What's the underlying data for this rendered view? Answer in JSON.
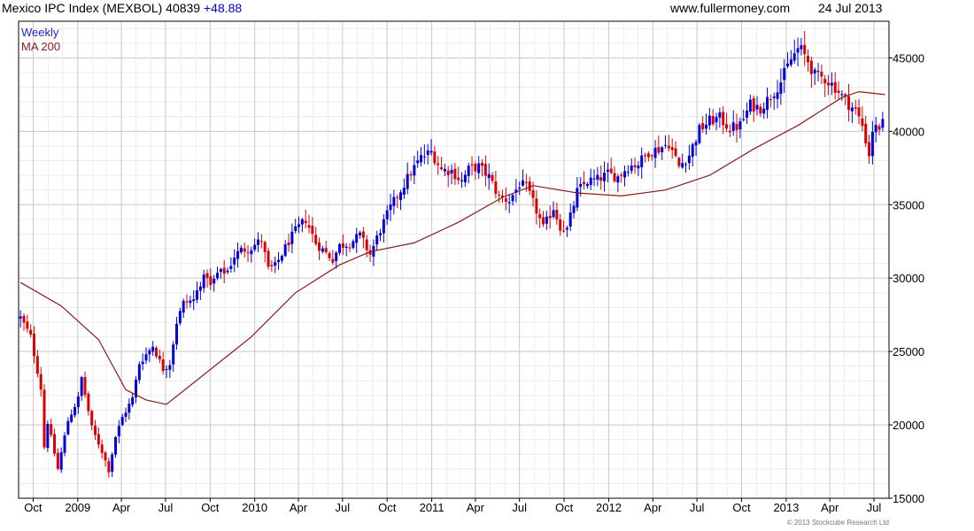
{
  "header": {
    "title": "Mexico IPC Index (MEXBOL) 40839",
    "change": "+48.88",
    "site": "www.fullermoney.com",
    "date": "24 Jul 2013"
  },
  "legend": {
    "weekly_label": "Weekly",
    "ma_label": "MA 200"
  },
  "copyright": "© 2013 Stockcube Research Ltd",
  "colors": {
    "up": "#0000dd",
    "down": "#dd0000",
    "ma": "#8b1a1a",
    "grid": "#dcdcdc",
    "weekly_text": "#2222cc",
    "ma_text": "#8b1a1a"
  },
  "chart_data": {
    "type": "candlestick",
    "title": "Mexico IPC Index (MEXBOL) 40839",
    "x_range": [
      "2008-09-01",
      "2013-08-01"
    ],
    "y_range": [
      15000,
      47500
    ],
    "y_ticks": [
      15000,
      20000,
      25000,
      30000,
      35000,
      40000,
      45000
    ],
    "x_ticks": [
      {
        "date": "2008-10-01",
        "label": "Oct"
      },
      {
        "date": "2009-01-01",
        "label": "2009"
      },
      {
        "date": "2009-04-01",
        "label": "Apr"
      },
      {
        "date": "2009-07-01",
        "label": "Jul"
      },
      {
        "date": "2009-10-01",
        "label": "Oct"
      },
      {
        "date": "2010-01-01",
        "label": "2010"
      },
      {
        "date": "2010-04-01",
        "label": "Apr"
      },
      {
        "date": "2010-07-01",
        "label": "Jul"
      },
      {
        "date": "2010-10-01",
        "label": "Oct"
      },
      {
        "date": "2011-01-01",
        "label": "2011"
      },
      {
        "date": "2011-04-01",
        "label": "Apr"
      },
      {
        "date": "2011-07-01",
        "label": "Jul"
      },
      {
        "date": "2011-10-01",
        "label": "Oct"
      },
      {
        "date": "2012-01-01",
        "label": "2012"
      },
      {
        "date": "2012-04-01",
        "label": "Apr"
      },
      {
        "date": "2012-07-01",
        "label": "Jul"
      },
      {
        "date": "2012-10-01",
        "label": "Oct"
      },
      {
        "date": "2013-01-01",
        "label": "2013"
      },
      {
        "date": "2013-04-01",
        "label": "Apr"
      },
      {
        "date": "2013-07-01",
        "label": "Jul"
      }
    ],
    "weekly_close_path": [
      [
        "2008-09-05",
        27300
      ],
      [
        "2008-09-26",
        26000
      ],
      [
        "2008-10-17",
        22500
      ],
      [
        "2008-10-24",
        18500
      ],
      [
        "2008-10-31",
        20200
      ],
      [
        "2008-11-21",
        17000
      ],
      [
        "2008-12-12",
        20300
      ],
      [
        "2009-01-02",
        21800
      ],
      [
        "2009-01-09",
        23200
      ],
      [
        "2009-01-30",
        19800
      ],
      [
        "2009-02-20",
        18200
      ],
      [
        "2009-03-06",
        16900
      ],
      [
        "2009-03-20",
        19200
      ],
      [
        "2009-04-03",
        20500
      ],
      [
        "2009-04-24",
        21800
      ],
      [
        "2009-05-08",
        24200
      ],
      [
        "2009-06-05",
        25400
      ],
      [
        "2009-06-26",
        23800
      ],
      [
        "2009-07-10",
        24200
      ],
      [
        "2009-07-24",
        27000
      ],
      [
        "2009-08-07",
        28300
      ],
      [
        "2009-08-28",
        28500
      ],
      [
        "2009-09-11",
        29700
      ],
      [
        "2009-09-25",
        30200
      ],
      [
        "2009-10-02",
        29400
      ],
      [
        "2009-10-16",
        30300
      ],
      [
        "2009-11-06",
        30500
      ],
      [
        "2009-11-20",
        31500
      ],
      [
        "2009-12-04",
        31900
      ],
      [
        "2009-12-25",
        32100
      ],
      [
        "2010-01-15",
        32600
      ],
      [
        "2010-01-29",
        30600
      ],
      [
        "2010-02-12",
        30800
      ],
      [
        "2010-03-12",
        32500
      ],
      [
        "2010-03-26",
        33200
      ],
      [
        "2010-04-16",
        34000
      ],
      [
        "2010-05-07",
        32400
      ],
      [
        "2010-05-28",
        31700
      ],
      [
        "2010-06-11",
        31300
      ],
      [
        "2010-06-25",
        32200
      ],
      [
        "2010-07-16",
        32400
      ],
      [
        "2010-08-06",
        32900
      ],
      [
        "2010-08-27",
        31600
      ],
      [
        "2010-09-17",
        33300
      ],
      [
        "2010-10-08",
        34800
      ],
      [
        "2010-10-29",
        36000
      ],
      [
        "2010-11-19",
        37200
      ],
      [
        "2010-12-10",
        38200
      ],
      [
        "2010-12-31",
        38600
      ],
      [
        "2011-01-21",
        37400
      ],
      [
        "2011-02-11",
        37300
      ],
      [
        "2011-03-04",
        36600
      ],
      [
        "2011-03-18",
        37400
      ],
      [
        "2011-04-08",
        37600
      ],
      [
        "2011-04-29",
        36900
      ],
      [
        "2011-05-20",
        35500
      ],
      [
        "2011-06-10",
        35300
      ],
      [
        "2011-07-01",
        36400
      ],
      [
        "2011-07-15",
        36200
      ],
      [
        "2011-08-05",
        34600
      ],
      [
        "2011-08-19",
        33400
      ],
      [
        "2011-09-09",
        34800
      ],
      [
        "2011-09-23",
        33500
      ],
      [
        "2011-10-07",
        33300
      ],
      [
        "2011-10-28",
        35900
      ],
      [
        "2011-11-18",
        36600
      ],
      [
        "2011-12-09",
        36700
      ],
      [
        "2011-12-30",
        37100
      ],
      [
        "2012-01-20",
        36900
      ],
      [
        "2012-02-10",
        37600
      ],
      [
        "2012-03-02",
        37800
      ],
      [
        "2012-03-23",
        38600
      ],
      [
        "2012-04-13",
        38800
      ],
      [
        "2012-05-04",
        39200
      ],
      [
        "2012-05-25",
        37600
      ],
      [
        "2012-06-15",
        38400
      ],
      [
        "2012-07-06",
        40100
      ],
      [
        "2012-07-27",
        40700
      ],
      [
        "2012-08-17",
        40900
      ],
      [
        "2012-09-07",
        40200
      ],
      [
        "2012-09-28",
        40400
      ],
      [
        "2012-10-19",
        41800
      ],
      [
        "2012-11-09",
        41600
      ],
      [
        "2012-11-30",
        42400
      ],
      [
        "2012-12-21",
        43400
      ],
      [
        "2013-01-11",
        44900
      ],
      [
        "2013-01-25",
        45600
      ],
      [
        "2013-02-01",
        45500
      ],
      [
        "2013-02-15",
        44800
      ],
      [
        "2013-03-01",
        43800
      ],
      [
        "2013-03-22",
        43600
      ],
      [
        "2013-04-12",
        43000
      ],
      [
        "2013-05-03",
        42100
      ],
      [
        "2013-05-24",
        41400
      ],
      [
        "2013-06-07",
        40400
      ],
      [
        "2013-06-21",
        38400
      ],
      [
        "2013-06-28",
        40100
      ],
      [
        "2013-07-12",
        40300
      ],
      [
        "2013-07-24",
        40839
      ]
    ],
    "ma200_path": [
      [
        "2008-09-05",
        29700
      ],
      [
        "2008-11-28",
        28100
      ],
      [
        "2009-02-13",
        25800
      ],
      [
        "2009-04-10",
        22400
      ],
      [
        "2009-05-22",
        21700
      ],
      [
        "2009-07-03",
        21400
      ],
      [
        "2009-09-25",
        23600
      ],
      [
        "2009-12-25",
        26000
      ],
      [
        "2010-03-26",
        29000
      ],
      [
        "2010-06-25",
        30900
      ],
      [
        "2010-08-27",
        31800
      ],
      [
        "2010-11-26",
        32400
      ],
      [
        "2011-02-25",
        33800
      ],
      [
        "2011-05-27",
        35500
      ],
      [
        "2011-07-29",
        36300
      ],
      [
        "2011-10-28",
        35800
      ],
      [
        "2012-01-27",
        35600
      ],
      [
        "2012-04-27",
        36000
      ],
      [
        "2012-07-27",
        37000
      ],
      [
        "2012-10-26",
        38800
      ],
      [
        "2013-01-25",
        40400
      ],
      [
        "2013-04-26",
        42300
      ],
      [
        "2013-05-31",
        42700
      ],
      [
        "2013-07-24",
        42500
      ]
    ]
  }
}
